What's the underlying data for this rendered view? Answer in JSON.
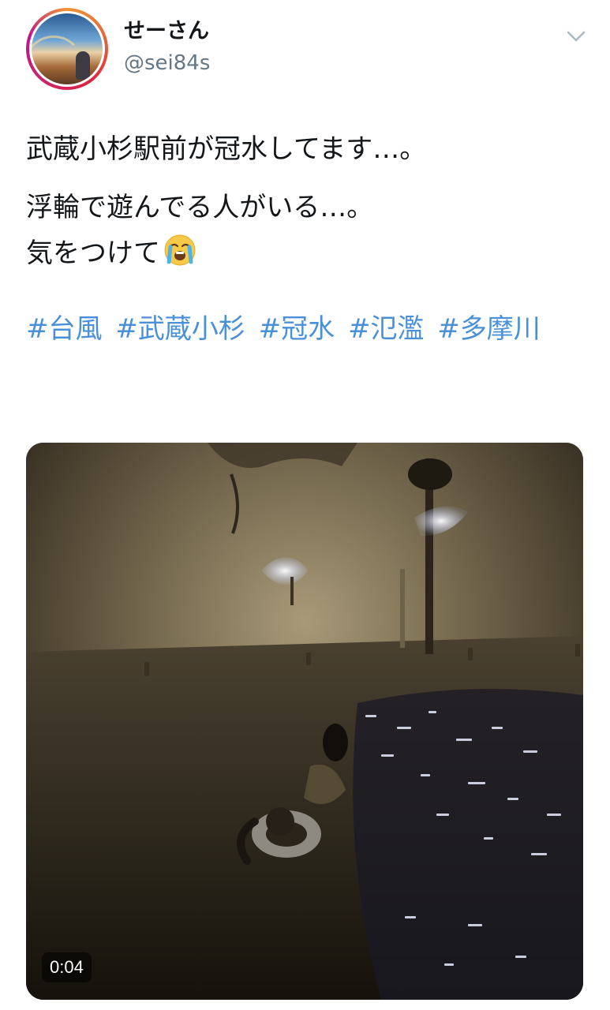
{
  "user": {
    "display_name": "せーさん",
    "handle": "@sei84s"
  },
  "tweet": {
    "line1": "武蔵小杉駅前が冠水してます…。",
    "line2": "浮輪で遊んでる人がいる…。",
    "line3": "気をつけて",
    "line3_emoji": "loudly-crying-face-emoji",
    "hashtags": [
      "#台風",
      "#武蔵小杉",
      "#冠水",
      "#氾濫",
      "#多摩川"
    ]
  },
  "media": {
    "type": "video",
    "duration": "0:04"
  },
  "icons": {
    "more": "chevron-down-icon"
  },
  "colors": {
    "link": "#4a90d9",
    "handle": "#657786",
    "text": "#14171a"
  }
}
